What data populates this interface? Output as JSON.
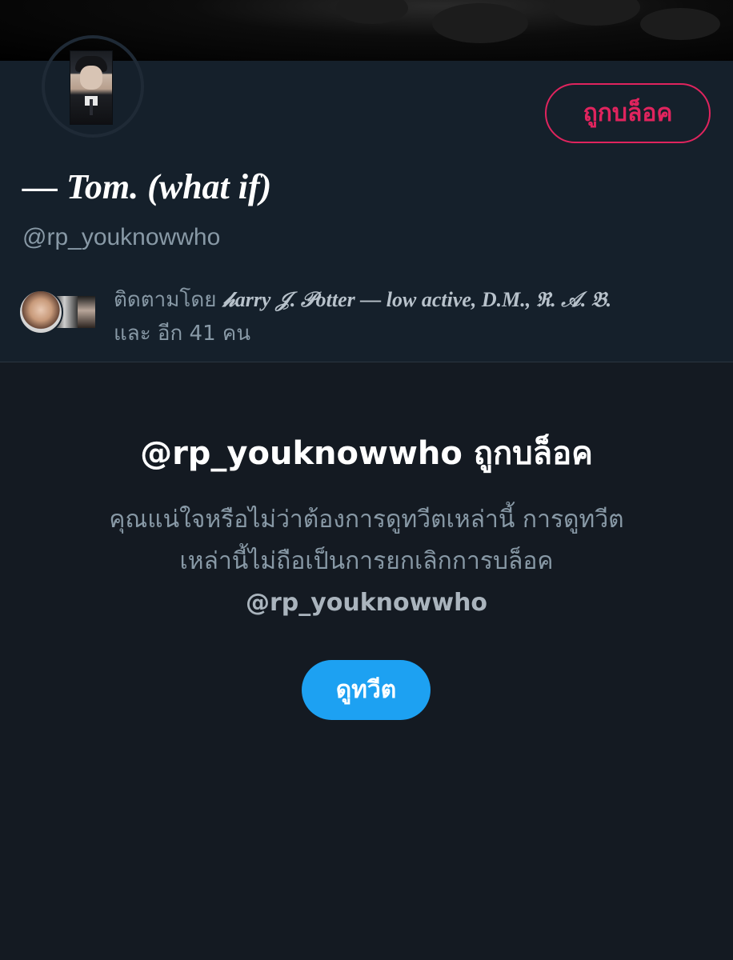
{
  "profile": {
    "display_name": "— Tom. (what if)",
    "handle": "@rp_youknowwho",
    "blocked_button_label": "ถูกบล็อค",
    "followed_by_prefix": "ติดตามโดย",
    "followed_by_names": "𝒽arry 𝒥. 𝒫otter — low active, D.M., ℜ. 𝒜. 𝔅.",
    "followed_by_more": "และ อีก 41 คน"
  },
  "blocked_notice": {
    "title": "@rp_youknowwho ถูกบล็อค",
    "description": "คุณแน่ใจหรือไม่ว่าต้องการดูทวีตเหล่านี้ การดูทวีตเหล่านี้ไม่ถือเป็นการยกเลิกการบล็อค",
    "description_handle": "@rp_youknowwho",
    "view_button_label": "ดูทวีต"
  },
  "colors": {
    "background": "#15202b",
    "danger": "#e0245e",
    "accent": "#1da1f2",
    "secondary_text": "#8899a6"
  }
}
